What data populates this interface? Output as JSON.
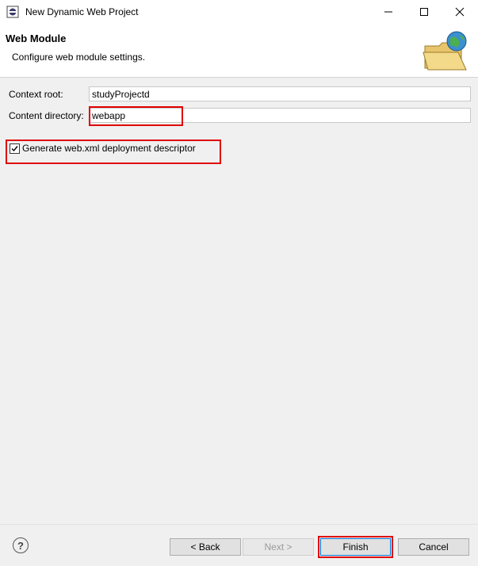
{
  "window": {
    "title": "New Dynamic Web Project",
    "controls": {
      "minimize": "minimize-icon",
      "maximize": "maximize-icon",
      "close": "close-icon"
    }
  },
  "header": {
    "title": "Web Module",
    "description": "Configure web module settings."
  },
  "form": {
    "context_root_label": "Context root:",
    "context_root_value": "studyProjectd",
    "content_directory_label": "Content directory:",
    "content_directory_value": "webapp",
    "generate_descriptor_label": "Generate web.xml deployment descriptor",
    "generate_descriptor_checked": true
  },
  "buttons": {
    "back": "< Back",
    "next": "Next >",
    "finish": "Finish",
    "cancel": "Cancel",
    "help": "?"
  },
  "colors": {
    "highlight": "#e00000",
    "dialog_bg": "#f0f0f0",
    "header_bg": "#ffffff"
  }
}
